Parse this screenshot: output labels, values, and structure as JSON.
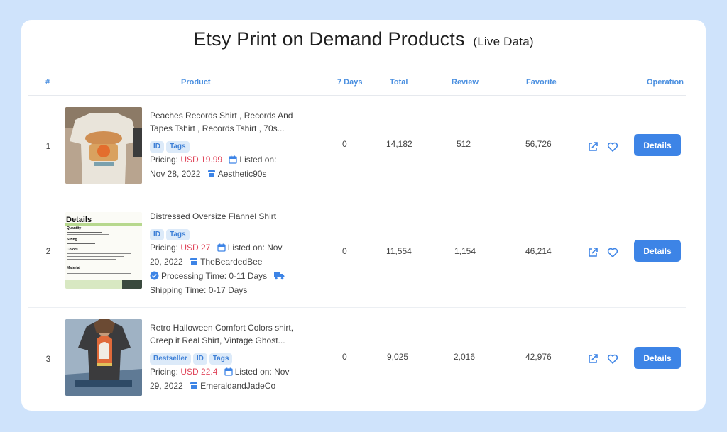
{
  "title": "Etsy Print on Demand Products",
  "subtitle": "(Live Data)",
  "columns": {
    "index": "#",
    "product": "Product",
    "days7": "7 Days",
    "total": "Total",
    "review": "Review",
    "favorite": "Favorite",
    "operation": "Operation"
  },
  "labels": {
    "pricing": "Pricing:",
    "listed": "Listed on:",
    "details": "Details"
  },
  "rows": [
    {
      "index": "1",
      "title_line1": "Peaches Records Shirt , Records And",
      "title_line2": "Tapes Tshirt , Records Tshirt , 70s...",
      "tags": [
        "ID",
        "Tags"
      ],
      "price": "USD 19.99",
      "listed_date": "Nov 28, 2022",
      "shop": "Aesthetic90s",
      "days7": "0",
      "total": "14,182",
      "review": "512",
      "favorite": "56,726"
    },
    {
      "index": "2",
      "title_line1": "Distressed Oversize Flannel Shirt",
      "tags": [
        "ID",
        "Tags"
      ],
      "price": "USD 27",
      "listed_date_part1": "Nov",
      "listed_date_part2": "20, 2022",
      "shop": "TheBeardedBee",
      "processing": "Processing Time: 0-11 Days",
      "shipping": "Shipping Time: 0-17 Days",
      "thumb_heading": "Details",
      "thumb_labels": [
        "Quantity",
        "Sizing",
        "Colors",
        "Material"
      ],
      "days7": "0",
      "total": "11,554",
      "review": "1,154",
      "favorite": "46,214"
    },
    {
      "index": "3",
      "title_line1": "Retro Halloween Comfort Colors shirt,",
      "title_line2": "Creep it Real Shirt, Vintage Ghost...",
      "tags": [
        "Bestseller",
        "ID",
        "Tags"
      ],
      "price": "USD 22.4",
      "listed_date_part1": "Nov",
      "listed_date_part2": "29, 2022",
      "shop": "EmeraldandJadeCo",
      "days7": "0",
      "total": "9,025",
      "review": "2,016",
      "favorite": "42,976"
    }
  ],
  "colors": {
    "background": "#cfe3fb",
    "accent": "#3d84e6",
    "price": "#e0465b",
    "tag_bg": "#dceaf9"
  }
}
